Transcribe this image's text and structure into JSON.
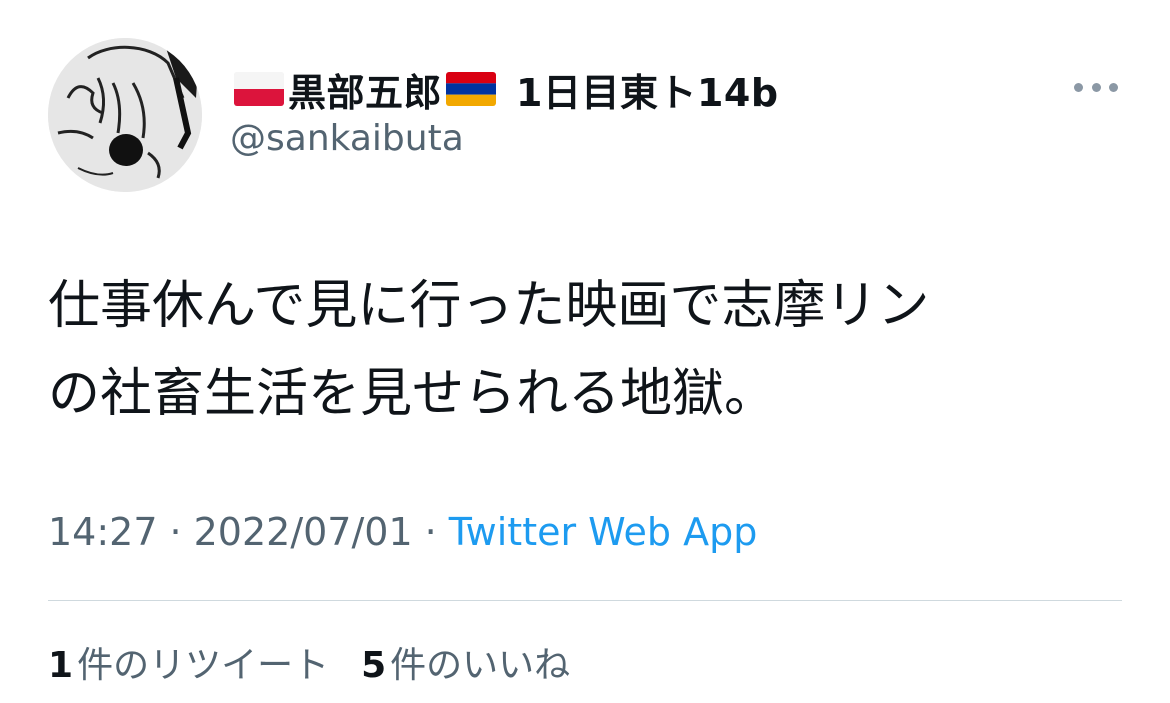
{
  "tweet": {
    "author": {
      "avatar_icon": "profile-avatar-drawing",
      "name_part1": "黒部五郎",
      "name_part2": "1日目東ト14b",
      "flag_left": "poland-flag-icon",
      "flag_right": "armenia-flag-icon",
      "handle": "@sankaibuta"
    },
    "more_icon": "more-dots-icon",
    "text_lines": [
      "仕事休んで見に行った映画で志摩リン",
      "の社畜生活を見せられる地獄。"
    ],
    "time": "14:27",
    "date": "2022/07/01",
    "separator": "·",
    "source": "Twitter Web App",
    "stats": {
      "retweets_count": "1",
      "retweets_label": "件のリツイート",
      "likes_count": "5",
      "likes_label": "件のいいね"
    }
  },
  "colors": {
    "text_primary": "#0f1419",
    "text_secondary": "#536471",
    "link": "#1d9bf0",
    "divider": "#cfd9de"
  }
}
